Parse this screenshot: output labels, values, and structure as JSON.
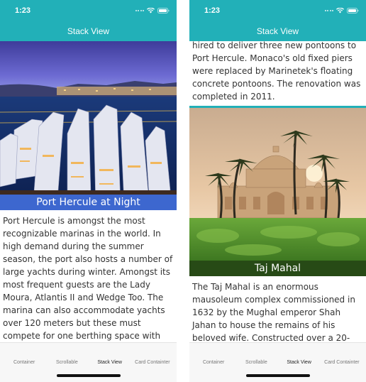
{
  "status": {
    "time": "1:23"
  },
  "nav": {
    "title": "Stack View"
  },
  "cards": {
    "port": {
      "title": "Port Hercule at Night",
      "text": "Port Hercule is amongst the most recognizable marinas in the world. In high demand during the summer season, the port also hosts a number of large yachts during winter. Amongst its most frequent guests are the Lady Moura, Atlantis II and Wedge Too. The marina can also accommodate yachts over 120 meters but these must compete for one berthing space with",
      "text_continued": "hired to deliver three new pontoons to Port Hercule. Monaco's old fixed piers were replaced by Marinetek's floating concrete pontoons. The renovation was completed in 2011."
    },
    "taj": {
      "title": "Taj Mahal",
      "text": "The Taj Mahal is an enormous mausoleum complex commissioned in 1632 by the Mughal emperor Shah Jahan to house the remains of his beloved wife. Constructed over a 20-"
    }
  },
  "tabs": [
    "Container",
    "Scrollable",
    "Stack View",
    "Card Containter"
  ],
  "colors": {
    "accent": "#22b0b8",
    "caption_blue": "#3d67cf",
    "caption_green": "#274a16"
  },
  "icons": [
    "cellular-dots-icon",
    "wifi-icon",
    "battery-icon"
  ]
}
